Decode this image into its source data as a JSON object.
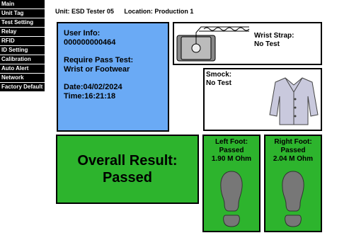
{
  "sidebar": {
    "items": [
      {
        "label": "Main"
      },
      {
        "label": "Unit Tag"
      },
      {
        "label": "Test Setting"
      },
      {
        "label": "Relay"
      },
      {
        "label": "RFID"
      },
      {
        "label": "ID Setting"
      },
      {
        "label": "Calibration"
      },
      {
        "label": "Auto Alert"
      },
      {
        "label": "Network"
      },
      {
        "label": "Factory Default"
      }
    ]
  },
  "header": {
    "unit": "Unit: ESD Tester 05",
    "location": "Location: Production 1"
  },
  "user": {
    "info_label": "User Info:",
    "id": "000000000464",
    "require_label": "Require Pass Test:",
    "require_value": "Wrist or Footwear",
    "date": "Date:04/02/2024",
    "time": "Time:16:21:18"
  },
  "wrist": {
    "label": "Wrist Strap:",
    "status": "No Test"
  },
  "smock": {
    "label": "Smock:",
    "status": "No Test"
  },
  "overall": {
    "title": "Overall Result:",
    "value": "Passed"
  },
  "left_foot": {
    "label": "Left Foot:",
    "status": "Passed",
    "resistance": "1.90 M Ohm"
  },
  "right_foot": {
    "label": "Right Foot:",
    "status": "Passed",
    "resistance": "2.04 M Ohm"
  },
  "colors": {
    "user_panel": "#6aaaf5",
    "pass_green": "#2db42d",
    "nav_bg": "#000000"
  }
}
